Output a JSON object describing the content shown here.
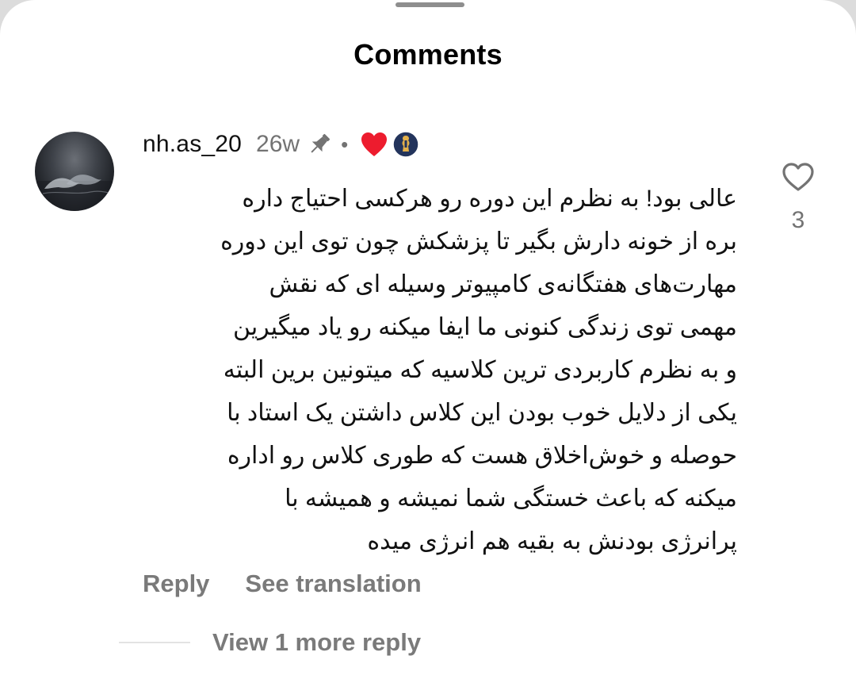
{
  "header": {
    "title": "Comments"
  },
  "comment": {
    "username": "nh.as_20",
    "time": "26w",
    "separator": "•",
    "pinned_icon": "pin-icon",
    "badges": [
      "liked-by-creator-heart-icon",
      "creator-avatar-badge-icon"
    ],
    "text_lines": [
      "عالی بود! به نظرم این دوره رو هرکسی احتیاج داره",
      "بره از خونه دارش بگیر تا پزشکش چون توی این دوره",
      "مهارت‌های هفتگانه‌ی کامپیوتر وسیله ای که نقش",
      "مهمی توی زندگی کنونی ما ایفا میکنه رو یاد میگیرین",
      "و به نظرم کاربردی ترین کلاسیه که میتونین برین البته",
      "یکی از دلایل خوب بودن این کلاس داشتن یک استاد با",
      "حوصله و خوش‌اخلاق هست که طوری کلاس رو اداره",
      "میکنه که باعث خستگی شما نمیشه و همیشه با",
      "پرانرژی بودنش به بقیه هم انرژی میده"
    ],
    "like_count": "3",
    "reply_label": "Reply",
    "translate_label": "See translation",
    "view_replies_label": "View 1 more reply"
  },
  "colors": {
    "background": "#ffffff",
    "secondary_text": "#737373",
    "heart_red": "#ed1c2e",
    "badge_navy": "#23345c",
    "badge_gold": "#e3b04a"
  }
}
